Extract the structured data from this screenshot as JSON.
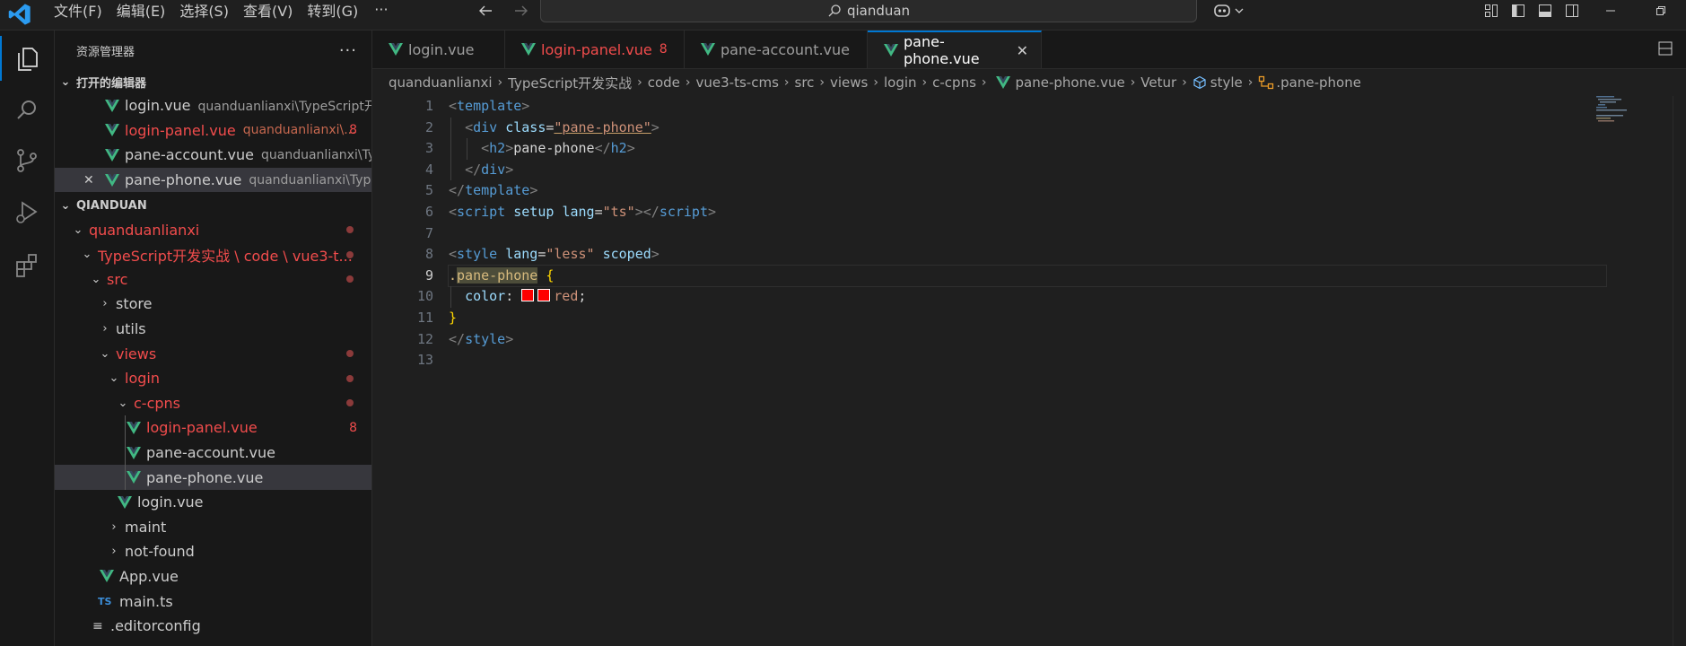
{
  "menu": {
    "file": "文件(F)",
    "edit": "编辑(E)",
    "selection": "选择(S)",
    "view": "查看(V)",
    "goto": "转到(G)",
    "more": "···"
  },
  "command_center": {
    "text": "qianduan"
  },
  "sidebar": {
    "title": "资源管理器",
    "open_editors": {
      "header": "打开的编辑器",
      "items": [
        {
          "name": "login.vue",
          "desc": "quanduanlianxi\\TypeScript开..."
        },
        {
          "name": "login-panel.vue",
          "desc": "quanduanlianxi\\...",
          "badge": "8"
        },
        {
          "name": "pane-account.vue",
          "desc": "quanduanlianxi\\Ty..."
        },
        {
          "name": "pane-phone.vue",
          "desc": "quanduanlianxi\\Type..."
        }
      ]
    },
    "workspace": {
      "header": "QIANDUAN",
      "items": [
        {
          "name": "quanduanlianxi"
        },
        {
          "name": "TypeScript开发实战 \\ code \\ vue3-t..."
        },
        {
          "name": "src"
        },
        {
          "name": "store"
        },
        {
          "name": "utils"
        },
        {
          "name": "views"
        },
        {
          "name": "login"
        },
        {
          "name": "c-cpns"
        },
        {
          "name": "login-panel.vue",
          "badge": "8"
        },
        {
          "name": "pane-account.vue"
        },
        {
          "name": "pane-phone.vue"
        },
        {
          "name": "login.vue"
        },
        {
          "name": "maint"
        },
        {
          "name": "not-found"
        },
        {
          "name": "App.vue"
        },
        {
          "name": "main.ts",
          "icon_text": "TS"
        },
        {
          "name": ".editorconfig"
        }
      ]
    }
  },
  "tabs": [
    {
      "label": "login.vue"
    },
    {
      "label": "login-panel.vue",
      "badge": "8"
    },
    {
      "label": "pane-account.vue"
    },
    {
      "label": "pane-phone.vue",
      "close": "✕"
    }
  ],
  "breadcrumbs": [
    "quanduanlianxi",
    "TypeScript开发实战",
    "code",
    "vue3-ts-cms",
    "src",
    "views",
    "login",
    "c-cpns",
    "pane-phone.vue",
    "Vetur",
    "style",
    ".pane-phone"
  ],
  "editor": {
    "current_line": 9,
    "line_numbers": [
      "1",
      "2",
      "3",
      "4",
      "5",
      "6",
      "7",
      "8",
      "9",
      "10",
      "11",
      "12",
      "13"
    ],
    "code": {
      "l1_tag": "template",
      "l2_tag": "div",
      "l2_attr": "class",
      "l2_val": "\"pane-phone\"",
      "l3_tag": "h2",
      "l3_text": "pane-phone",
      "l4_tag": "div",
      "l5_tag": "template",
      "l6_tag": "script",
      "l6_attr1": "setup",
      "l6_attr2": "lang",
      "l6_val": "\"ts\"",
      "l8_tag": "style",
      "l8_attr1": "lang",
      "l8_val": "\"less\"",
      "l8_attr2": "scoped",
      "l9_selector": "pane-phone",
      "l9_brace": "{",
      "l10_prop": "color",
      "l10_value": "red",
      "l11_brace": "}",
      "l12_tag": "style"
    }
  },
  "colors": {
    "accent": "#0078d4",
    "modified": "#f14c4c",
    "vue_green": "#41b883",
    "swatch": "#ff0000"
  }
}
